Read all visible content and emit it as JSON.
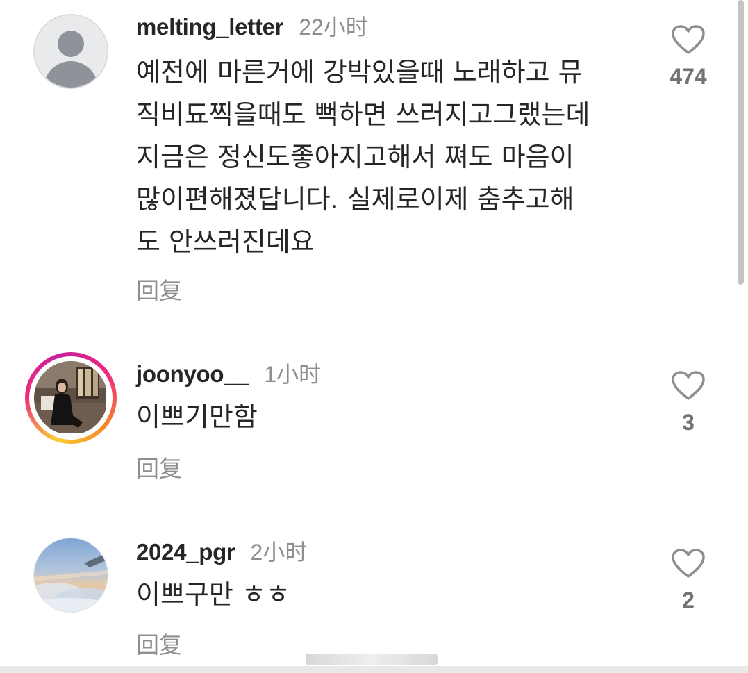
{
  "comments": [
    {
      "username": "melting_letter",
      "time": "22小时",
      "text_lines": [
        "예전에 마른거에 강박있을때 노래하고 뮤",
        "직비됴찍을때도 뻑하면 쓰러지고그랬는데",
        "지금은 정신도좋아지고해서 쪄도 마음이",
        "많이편해졌답니다. 실제로이제 춤추고해",
        "도 안쓰러진데요"
      ],
      "reply_label": "回复",
      "likes": "474",
      "avatar": "default-user-avatar",
      "liked": false
    },
    {
      "username": "joonyoo__",
      "time": "1小时",
      "text_lines": [
        "이쁘기만함"
      ],
      "reply_label": "回复",
      "likes": "3",
      "avatar": "story-ring-photo-avatar",
      "liked": false
    },
    {
      "username": "2024_pgr",
      "time": "2小时",
      "text_lines": [
        "이쁘구만 ㅎㅎ"
      ],
      "reply_label": "回复",
      "likes": "2",
      "avatar": "sky-airplane-photo-avatar",
      "liked": false
    }
  ],
  "colors": {
    "username": "#262626",
    "secondary_text": "#8e8e8e",
    "like_count": "#737373",
    "heart_outline": "#8e8e8e",
    "story_ring": [
      "#f9ce34",
      "#ee2a7b",
      "#c81f9e"
    ]
  },
  "icons": {
    "like": "heart-outline-icon"
  }
}
